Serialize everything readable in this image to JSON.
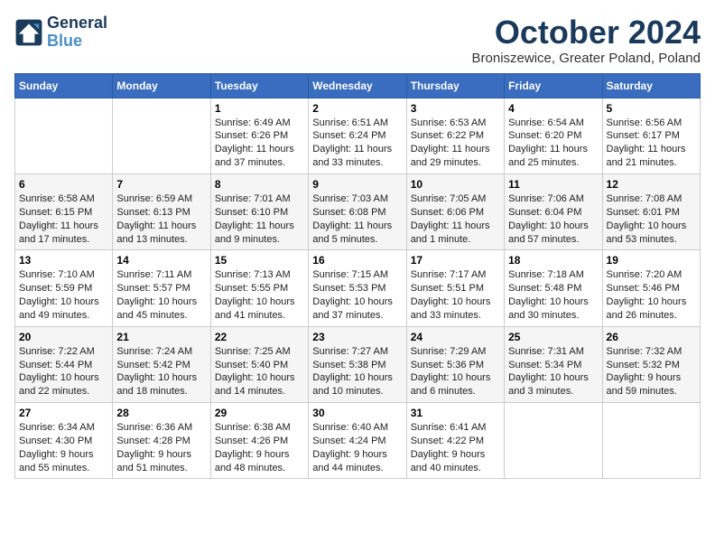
{
  "header": {
    "logo_line1": "General",
    "logo_line2": "Blue",
    "month_title": "October 2024",
    "location": "Broniszewice, Greater Poland, Poland"
  },
  "weekdays": [
    "Sunday",
    "Monday",
    "Tuesday",
    "Wednesday",
    "Thursday",
    "Friday",
    "Saturday"
  ],
  "weeks": [
    [
      {
        "day": "",
        "content": ""
      },
      {
        "day": "",
        "content": ""
      },
      {
        "day": "1",
        "content": "Sunrise: 6:49 AM\nSunset: 6:26 PM\nDaylight: 11 hours\nand 37 minutes."
      },
      {
        "day": "2",
        "content": "Sunrise: 6:51 AM\nSunset: 6:24 PM\nDaylight: 11 hours\nand 33 minutes."
      },
      {
        "day": "3",
        "content": "Sunrise: 6:53 AM\nSunset: 6:22 PM\nDaylight: 11 hours\nand 29 minutes."
      },
      {
        "day": "4",
        "content": "Sunrise: 6:54 AM\nSunset: 6:20 PM\nDaylight: 11 hours\nand 25 minutes."
      },
      {
        "day": "5",
        "content": "Sunrise: 6:56 AM\nSunset: 6:17 PM\nDaylight: 11 hours\nand 21 minutes."
      }
    ],
    [
      {
        "day": "6",
        "content": "Sunrise: 6:58 AM\nSunset: 6:15 PM\nDaylight: 11 hours\nand 17 minutes."
      },
      {
        "day": "7",
        "content": "Sunrise: 6:59 AM\nSunset: 6:13 PM\nDaylight: 11 hours\nand 13 minutes."
      },
      {
        "day": "8",
        "content": "Sunrise: 7:01 AM\nSunset: 6:10 PM\nDaylight: 11 hours\nand 9 minutes."
      },
      {
        "day": "9",
        "content": "Sunrise: 7:03 AM\nSunset: 6:08 PM\nDaylight: 11 hours\nand 5 minutes."
      },
      {
        "day": "10",
        "content": "Sunrise: 7:05 AM\nSunset: 6:06 PM\nDaylight: 11 hours\nand 1 minute."
      },
      {
        "day": "11",
        "content": "Sunrise: 7:06 AM\nSunset: 6:04 PM\nDaylight: 10 hours\nand 57 minutes."
      },
      {
        "day": "12",
        "content": "Sunrise: 7:08 AM\nSunset: 6:01 PM\nDaylight: 10 hours\nand 53 minutes."
      }
    ],
    [
      {
        "day": "13",
        "content": "Sunrise: 7:10 AM\nSunset: 5:59 PM\nDaylight: 10 hours\nand 49 minutes."
      },
      {
        "day": "14",
        "content": "Sunrise: 7:11 AM\nSunset: 5:57 PM\nDaylight: 10 hours\nand 45 minutes."
      },
      {
        "day": "15",
        "content": "Sunrise: 7:13 AM\nSunset: 5:55 PM\nDaylight: 10 hours\nand 41 minutes."
      },
      {
        "day": "16",
        "content": "Sunrise: 7:15 AM\nSunset: 5:53 PM\nDaylight: 10 hours\nand 37 minutes."
      },
      {
        "day": "17",
        "content": "Sunrise: 7:17 AM\nSunset: 5:51 PM\nDaylight: 10 hours\nand 33 minutes."
      },
      {
        "day": "18",
        "content": "Sunrise: 7:18 AM\nSunset: 5:48 PM\nDaylight: 10 hours\nand 30 minutes."
      },
      {
        "day": "19",
        "content": "Sunrise: 7:20 AM\nSunset: 5:46 PM\nDaylight: 10 hours\nand 26 minutes."
      }
    ],
    [
      {
        "day": "20",
        "content": "Sunrise: 7:22 AM\nSunset: 5:44 PM\nDaylight: 10 hours\nand 22 minutes."
      },
      {
        "day": "21",
        "content": "Sunrise: 7:24 AM\nSunset: 5:42 PM\nDaylight: 10 hours\nand 18 minutes."
      },
      {
        "day": "22",
        "content": "Sunrise: 7:25 AM\nSunset: 5:40 PM\nDaylight: 10 hours\nand 14 minutes."
      },
      {
        "day": "23",
        "content": "Sunrise: 7:27 AM\nSunset: 5:38 PM\nDaylight: 10 hours\nand 10 minutes."
      },
      {
        "day": "24",
        "content": "Sunrise: 7:29 AM\nSunset: 5:36 PM\nDaylight: 10 hours\nand 6 minutes."
      },
      {
        "day": "25",
        "content": "Sunrise: 7:31 AM\nSunset: 5:34 PM\nDaylight: 10 hours\nand 3 minutes."
      },
      {
        "day": "26",
        "content": "Sunrise: 7:32 AM\nSunset: 5:32 PM\nDaylight: 9 hours\nand 59 minutes."
      }
    ],
    [
      {
        "day": "27",
        "content": "Sunrise: 6:34 AM\nSunset: 4:30 PM\nDaylight: 9 hours\nand 55 minutes."
      },
      {
        "day": "28",
        "content": "Sunrise: 6:36 AM\nSunset: 4:28 PM\nDaylight: 9 hours\nand 51 minutes."
      },
      {
        "day": "29",
        "content": "Sunrise: 6:38 AM\nSunset: 4:26 PM\nDaylight: 9 hours\nand 48 minutes."
      },
      {
        "day": "30",
        "content": "Sunrise: 6:40 AM\nSunset: 4:24 PM\nDaylight: 9 hours\nand 44 minutes."
      },
      {
        "day": "31",
        "content": "Sunrise: 6:41 AM\nSunset: 4:22 PM\nDaylight: 9 hours\nand 40 minutes."
      },
      {
        "day": "",
        "content": ""
      },
      {
        "day": "",
        "content": ""
      }
    ]
  ]
}
